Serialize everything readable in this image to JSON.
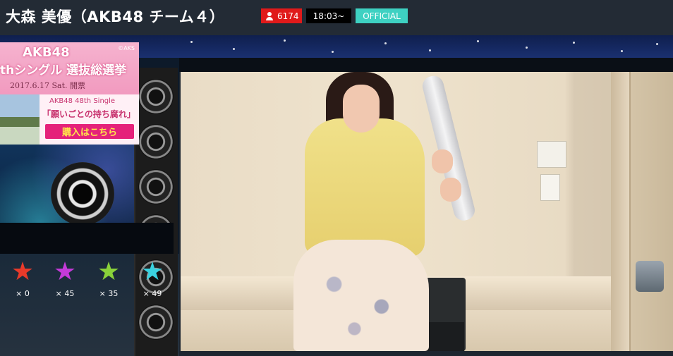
{
  "header": {
    "title": "大森 美優（AKB48 チーム４）",
    "viewer_count": "6174",
    "start_time": "18:03~",
    "official_badge": "OFFICIAL"
  },
  "ad": {
    "copyright": "©AKS",
    "line1": "AKB48",
    "line2": "thシングル 選抜総選挙",
    "date": "2017.6.17 Sat. 開票",
    "single_label": "AKB48 48th Single",
    "song": "「願いごとの持ち腐れ」",
    "buy_label": "購入はこちら"
  },
  "stars": [
    {
      "color": "#e83a2a",
      "count": "× 0"
    },
    {
      "color": "#c43ad8",
      "count": "× 45"
    },
    {
      "color": "#8ad23a",
      "count": "× 35"
    },
    {
      "color": "#3ad2e0",
      "count": "× 49"
    }
  ],
  "colors": {
    "viewer_badge": "#e01a1a",
    "official_badge": "#3ed1c2",
    "header_bg": "#232b35"
  }
}
